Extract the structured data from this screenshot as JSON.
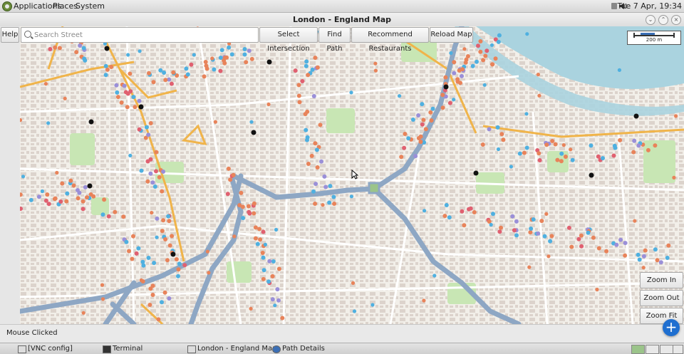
{
  "panel": {
    "menus": [
      "Applications",
      "Places",
      "System"
    ],
    "clock": "Tue 7 Apr, 19:34"
  },
  "window": {
    "title": "London - England Map"
  },
  "toolbar": {
    "help": "Help",
    "search_placeholder": "Search Street",
    "select_intersection": "Select Intersection",
    "find_path": "Find Path",
    "recommend_restaurants": "Recommend Restaurants",
    "reload_map": "Reload Map"
  },
  "map": {
    "scale_label": "200 m",
    "zoom_in": "Zoom In",
    "zoom_out": "Zoom Out",
    "zoom_fit": "Zoom Fit",
    "colors": {
      "land": "#f2efe9",
      "water": "#aad3df",
      "park": "#c8e6b4",
      "building": "#d9d0c9",
      "major_road": "#8ea7c4",
      "primary_road": "#f0b44a",
      "restaurant_poi": "#e8835a",
      "blue_poi": "#4fb0e0",
      "intersection": "#111111"
    }
  },
  "status": {
    "text": "Mouse Clicked"
  },
  "taskbar": {
    "items": [
      "[VNC config]",
      "Terminal",
      "London - England Map",
      "Path Details"
    ]
  }
}
